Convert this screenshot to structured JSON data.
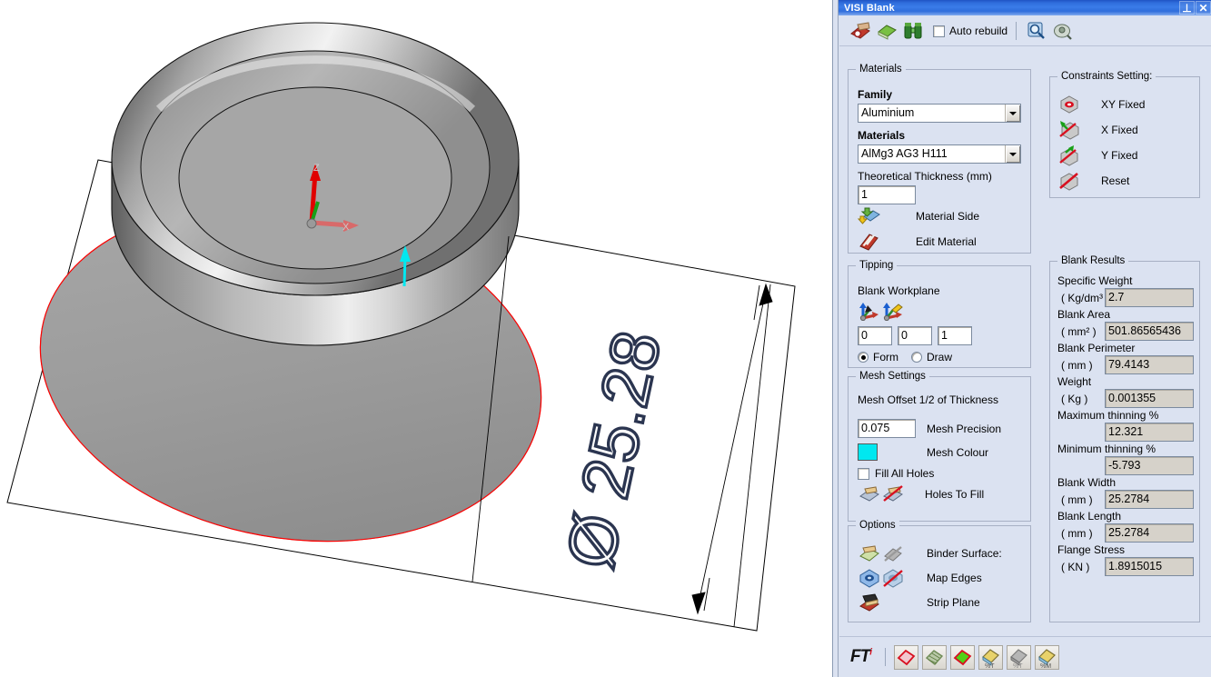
{
  "window": {
    "title": "VISI Blank",
    "pin_label": "⊥",
    "close_label": "✕"
  },
  "toolbar_top": {
    "icons": [
      {
        "name": "calculate-blank-icon",
        "title": "Calculate Blank"
      },
      {
        "name": "blank-layers-icon",
        "title": "Blank Layers"
      },
      {
        "name": "binoculars-icon",
        "title": "Find"
      }
    ],
    "auto_rebuild_label": "Auto rebuild",
    "auto_rebuild_checked": false,
    "right_icons": [
      {
        "name": "zoom-report-icon",
        "title": "Report"
      },
      {
        "name": "preview-icon",
        "title": "Preview"
      }
    ]
  },
  "materials": {
    "caption": "Materials",
    "family_label": "Family",
    "family_value": "Aluminium",
    "materials_label": "Materials",
    "materials_value": "AlMg3 AG3 H111",
    "thickness_label": "Theoretical Thickness (mm)",
    "thickness_value": "1",
    "material_side_label": "Material Side",
    "material_side_icon": "material-side-icon",
    "edit_material_label": "Edit Material",
    "edit_material_icon": "edit-material-book-icon"
  },
  "tipping": {
    "caption": "Tipping",
    "workplane_label": "Blank Workplane",
    "icons": [
      {
        "name": "workplane-pick-icon"
      },
      {
        "name": "workplane-edit-icon"
      }
    ],
    "vector": [
      "0",
      "0",
      "1"
    ],
    "mode_form_label": "Form",
    "mode_draw_label": "Draw",
    "mode_selected": "Form"
  },
  "mesh_settings": {
    "caption": "Mesh Settings",
    "offset_label": "Mesh Offset 1/2 of Thickness",
    "precision_value": "0.075",
    "precision_label": "Mesh Precision",
    "colour_label": "Mesh Colour",
    "colour_value": "#00E8F0",
    "fill_all_holes_label": "Fill All Holes",
    "fill_all_holes_checked": false,
    "holes_to_fill_label": "Holes To Fill",
    "holes_icons": [
      {
        "name": "add-hole-fill-icon"
      },
      {
        "name": "remove-hole-fill-icon"
      }
    ]
  },
  "options": {
    "caption": "Options",
    "rows": [
      {
        "label": "Binder Surface:",
        "icons": [
          "binder-surface-add-icon",
          "binder-surface-remove-icon"
        ]
      },
      {
        "label": "Map Edges",
        "icons": [
          "map-edges-add-icon",
          "map-edges-remove-icon"
        ]
      },
      {
        "label": "Strip Plane",
        "icons": [
          "strip-plane-icon"
        ]
      }
    ]
  },
  "constraints": {
    "caption": "Constraints Setting:",
    "rows": [
      {
        "label": "XY Fixed",
        "icon": "constraint-xy-fixed-icon"
      },
      {
        "label": "X Fixed",
        "icon": "constraint-x-fixed-icon"
      },
      {
        "label": "Y Fixed",
        "icon": "constraint-y-fixed-icon"
      },
      {
        "label": "Reset",
        "icon": "constraint-reset-icon"
      }
    ]
  },
  "blank_results": {
    "caption": "Blank Results",
    "rows": [
      {
        "label": "Specific Weight",
        "unit": "( Kg/dm³ )",
        "value": "2.7"
      },
      {
        "label": "Blank Area",
        "unit": "( mm² )",
        "value": "501.86565436"
      },
      {
        "label": "Blank Perimeter",
        "unit": "( mm )",
        "value": "79.4143"
      },
      {
        "label": "Weight",
        "unit": "( Kg )",
        "value": "0.001355"
      },
      {
        "label": "Maximum thinning %",
        "unit": "",
        "value": "12.321"
      },
      {
        "label": "Minimum thinning %",
        "unit": "",
        "value": "-5.793"
      },
      {
        "label": "Blank Width",
        "unit": "( mm )",
        "value": "25.2784"
      },
      {
        "label": "Blank Length",
        "unit": "( mm )",
        "value": "25.2784"
      },
      {
        "label": "Flange Stress",
        "unit": "( KN )",
        "value": "1.8915015"
      }
    ]
  },
  "toolbar_bottom": {
    "logo": "FT",
    "logo_sup": "i",
    "buttons": [
      {
        "name": "show-blank-outline-button"
      },
      {
        "name": "show-mesh-button"
      },
      {
        "name": "show-filled-blank-button"
      },
      {
        "name": "thinning-percent-t-button"
      },
      {
        "name": "thinning-grey-button"
      },
      {
        "name": "thinning-percent-m-button"
      }
    ]
  },
  "viewport": {
    "dimension_text": "Ø 25.28",
    "axis_z_label": "Z",
    "axis_x_label": "X",
    "colors": {
      "blank_outline": "#ff0000",
      "model_edge": "#000000",
      "dimension": "#2b3550",
      "normal_arrow": "#00e8f0",
      "axis_red": "#e00000"
    }
  }
}
